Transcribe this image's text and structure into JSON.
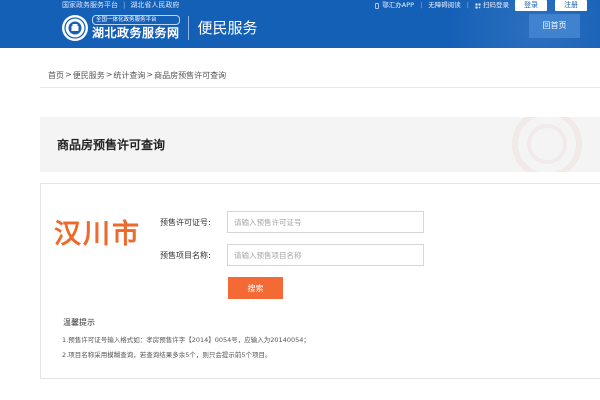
{
  "header": {
    "top_left": [
      "国家政务服务平台",
      "湖北省人民政府"
    ],
    "top_right": {
      "app": "鄂汇办APP",
      "accessible": "无障碍阅读",
      "scan_login": "扫码登录",
      "login": "登录",
      "register": "注册"
    },
    "logo": {
      "sub": "全国一体化政务服务平台",
      "main": "湖北政务服务网"
    },
    "channel": "便民服务",
    "home_button": "回首页"
  },
  "breadcrumb": [
    "首页",
    "便民服务",
    "统计查询",
    "商品房预售许可查询"
  ],
  "breadcrumb_separator": ">",
  "page_title": "商品房预售许可查询",
  "form": {
    "city": "汉川市",
    "license_label": "预售许可证号:",
    "license_placeholder": "请输入预售许可证号",
    "project_label": "预售项目名称:",
    "project_placeholder": "请输入预售项目名称",
    "search_button": "搜索"
  },
  "tips": {
    "title": "温馨提示",
    "items": [
      "1.预售许可证号输入格式如：孝房预售许字【2014】0054号，应输入为20140054；",
      "2.项目名称采用模糊查询，若查询结果多余5个，则只会提示前5个项目。"
    ]
  },
  "colors": {
    "header_blue": "#1560b7",
    "search_orange": "#f36a37",
    "city_orange": "#ee6a2a",
    "title_band": "#f4f4f4"
  },
  "icons": [
    "phone-icon",
    "accessibility-icon",
    "qr-icon",
    "emblem-icon"
  ]
}
